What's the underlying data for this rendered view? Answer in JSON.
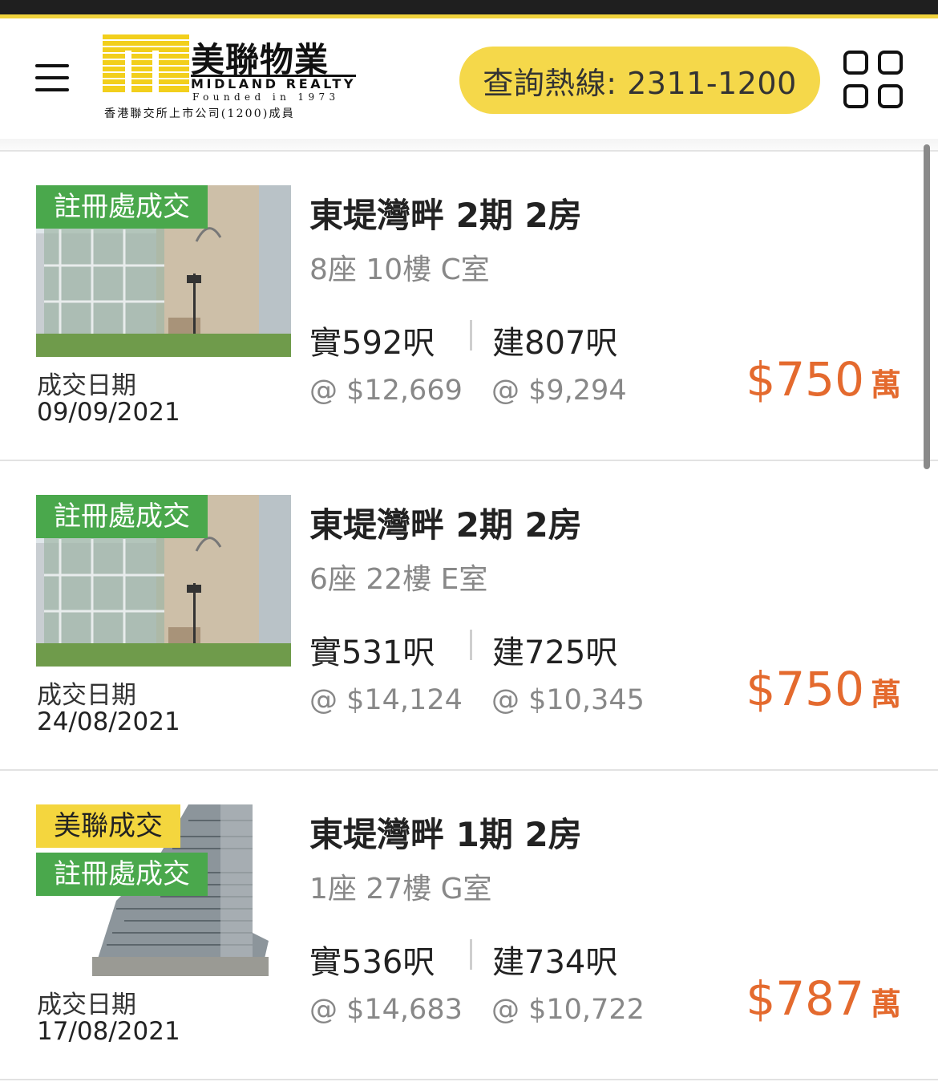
{
  "header": {
    "logo_cn": "美聯物業",
    "logo_en": "MIDLAND REALTY",
    "logo_founded": "Founded in 1973",
    "logo_sub": "香港聯交所上市公司(1200)成員",
    "hotline_label": "查詢熱線: 2311-1200",
    "menu_icon": "hamburger-menu-icon",
    "apps_icon": "grid-apps-icon"
  },
  "transactions": [
    {
      "badges": [
        "註冊處成交"
      ],
      "date_label": "成交日期",
      "date": "09/09/2021",
      "title": "東堤灣畔 2期 2房",
      "unit": "8座 10樓 C室",
      "net_area": "實592呎",
      "gross_area": "建807呎",
      "net_ppsf": "@ $12,669",
      "gross_ppsf": "@ $9,294",
      "price": "$750",
      "price_unit": "萬"
    },
    {
      "badges": [
        "註冊處成交"
      ],
      "date_label": "成交日期",
      "date": "24/08/2021",
      "title": "東堤灣畔 2期 2房",
      "unit": "6座 22樓 E室",
      "net_area": "實531呎",
      "gross_area": "建725呎",
      "net_ppsf": "@ $14,124",
      "gross_ppsf": "@ $10,345",
      "price": "$750",
      "price_unit": "萬"
    },
    {
      "badges": [
        "美聯成交",
        "註冊處成交"
      ],
      "date_label": "成交日期",
      "date": "17/08/2021",
      "title": "東堤灣畔 1期 2房",
      "unit": "1座 27樓 G室",
      "net_area": "實536呎",
      "gross_area": "建734呎",
      "net_ppsf": "@ $14,683",
      "gross_ppsf": "@ $10,722",
      "price": "$787",
      "price_unit": "萬"
    }
  ],
  "colors": {
    "accent_yellow": "#f5d84a",
    "badge_green": "#4aa84c",
    "badge_yellow": "#f4d63e",
    "price_orange": "#e46a2e"
  }
}
